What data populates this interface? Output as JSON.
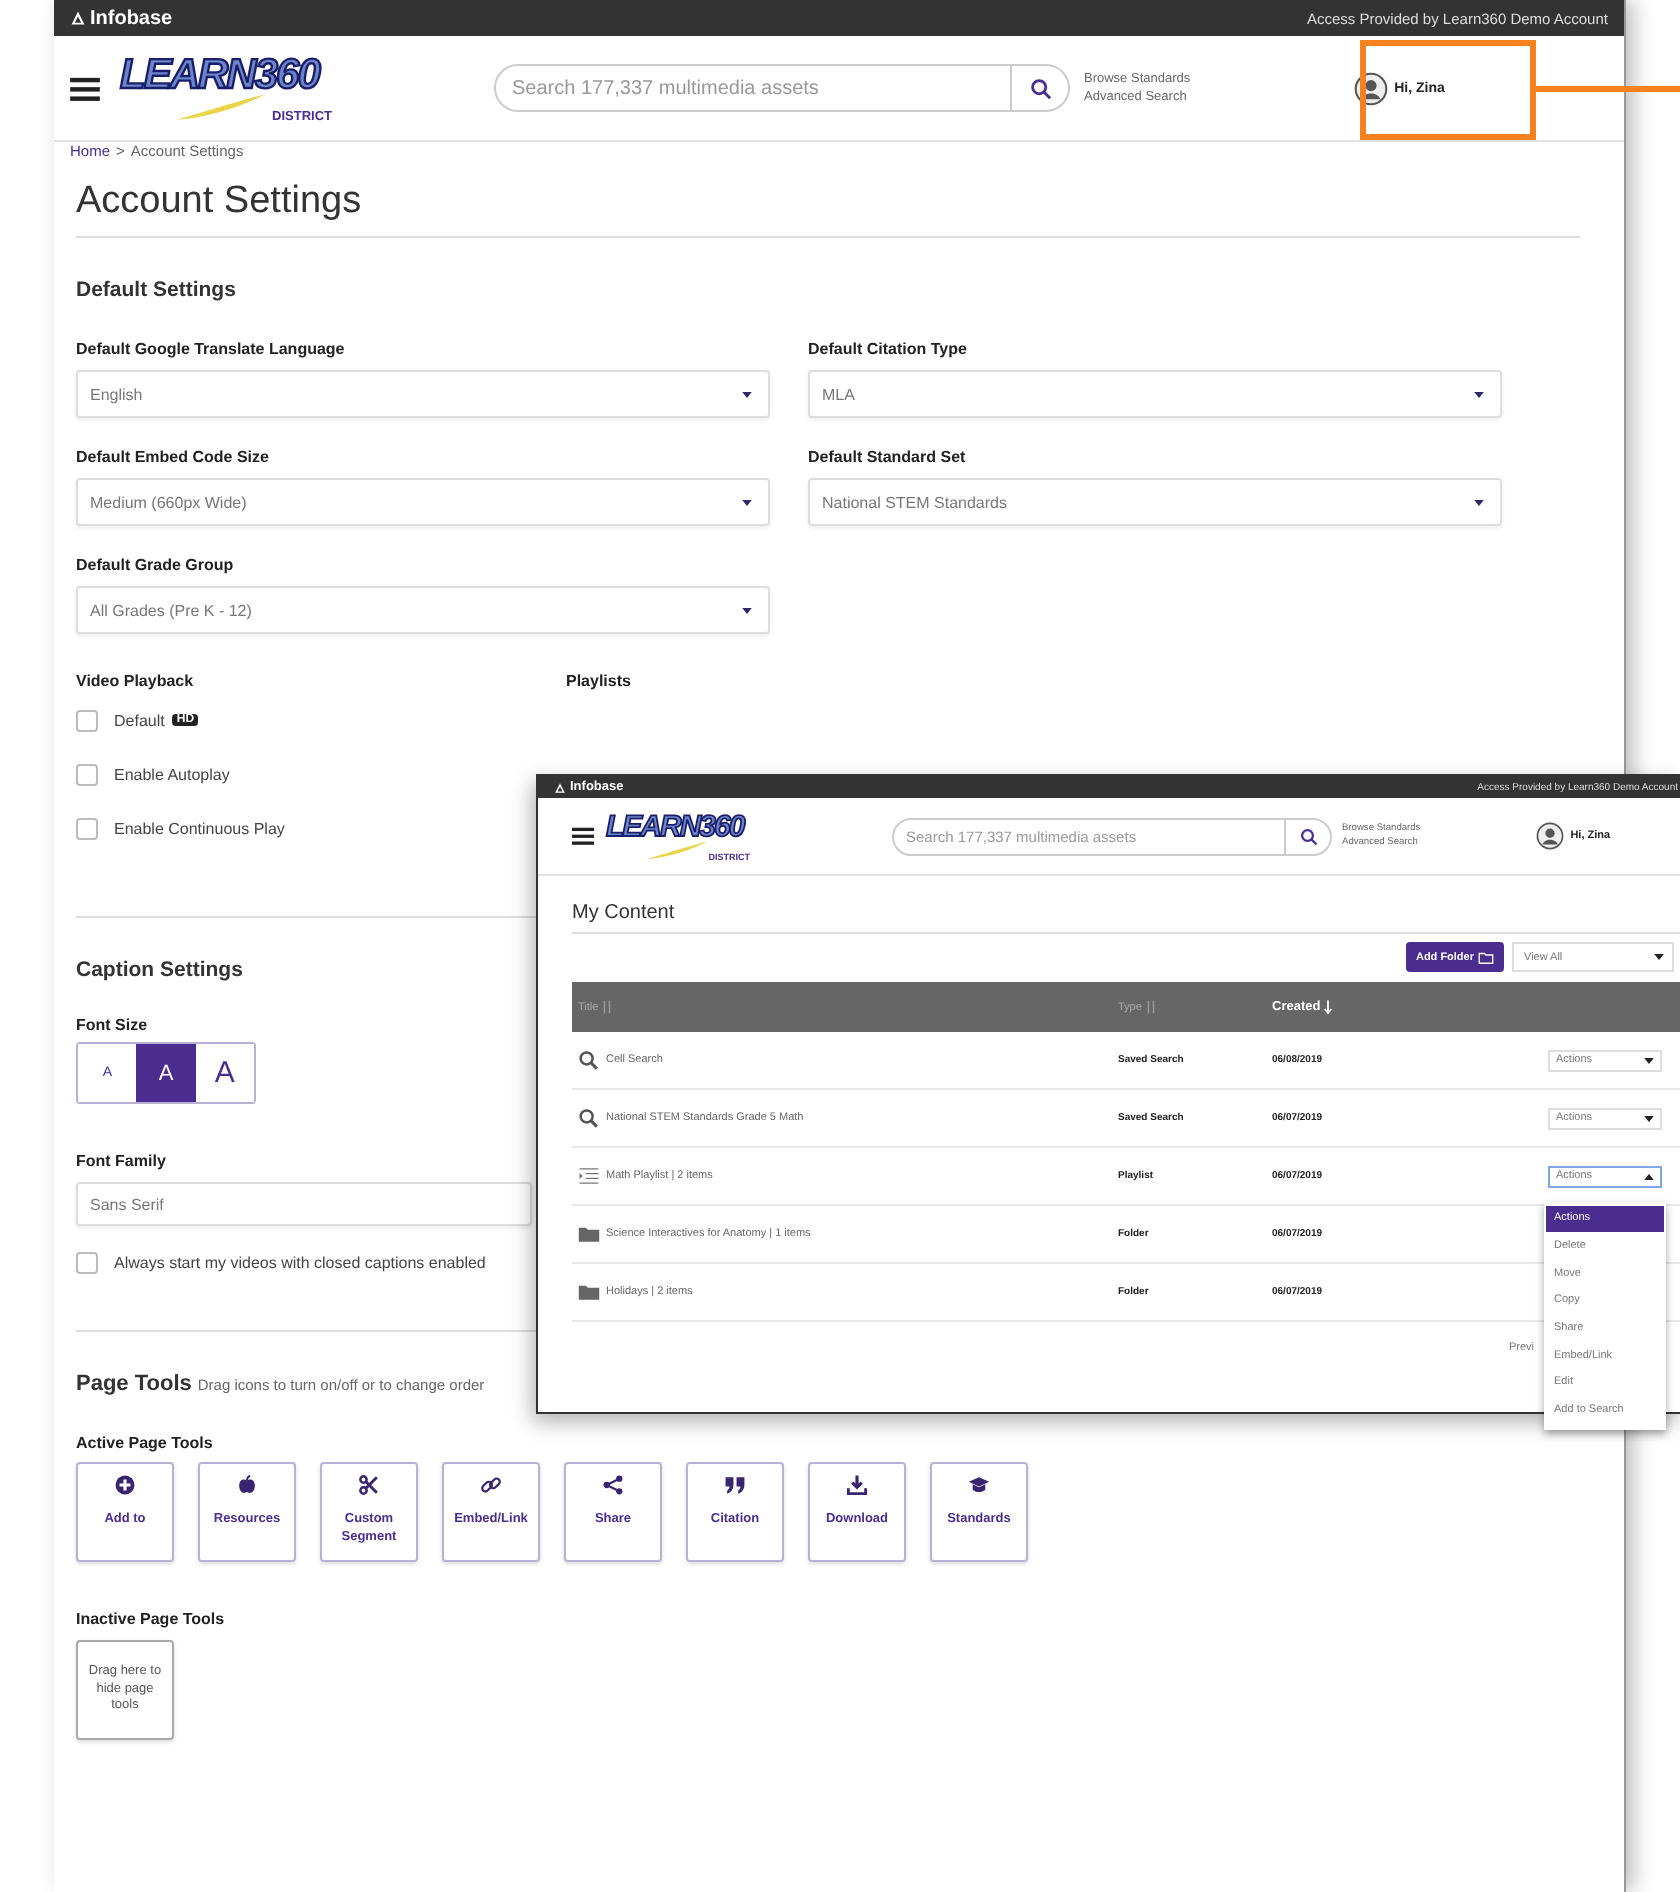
{
  "main": {
    "topbar": {
      "brand": "Infobase",
      "access": "Access Provided by Learn360 Demo Account"
    },
    "header": {
      "logo": "LEARN360",
      "logo_sub": "DISTRICT",
      "search_placeholder": "Search 177,337 multimedia assets",
      "links": [
        "Browse Standards",
        "Advanced Search"
      ],
      "user": "Hi, Zina",
      "user_highlighted": true
    },
    "breadcrumb": {
      "home": "Home",
      "separator": ">",
      "current": "Account Settings"
    },
    "title": "Account Settings",
    "default_settings": {
      "heading": "Default Settings",
      "selects": [
        {
          "label": "Default Google Translate Language",
          "value": "English"
        },
        {
          "label": "Default Citation Type",
          "value": "MLA"
        },
        {
          "label": "Default Embed Code Size",
          "value": "Medium (660px Wide)"
        },
        {
          "label": "Default Standard Set",
          "value": "National STEM Standards"
        },
        {
          "label": "Default Grade Group",
          "value": "All Grades (Pre K - 12)"
        }
      ]
    },
    "video_playback": {
      "heading": "Video Playback",
      "options": [
        {
          "label": "Default",
          "badge": "HD",
          "checked": false
        },
        {
          "label": "Enable Autoplay",
          "checked": false
        },
        {
          "label": "Enable Continuous Play",
          "checked": false
        }
      ]
    },
    "playlists": {
      "heading": "Playlists"
    },
    "caption_settings": {
      "heading": "Caption Settings",
      "font_size_label": "Font Size",
      "font_sizes": [
        {
          "label": "A",
          "kind": "small",
          "selected": false
        },
        {
          "label": "A",
          "kind": "medium",
          "selected": true
        },
        {
          "label": "A",
          "kind": "large",
          "selected": false
        }
      ],
      "font_family_label": "Font Family",
      "font_family": "Sans Serif",
      "closed_captions": {
        "label": "Always start my videos with closed captions enabled",
        "checked": false
      }
    },
    "page_tools": {
      "heading": "Page Tools",
      "hint": "Drag icons to turn on/off or to change order",
      "active_label": "Active Page Tools",
      "active": [
        {
          "label": "Add to",
          "kind": "add"
        },
        {
          "label": "Resources",
          "kind": "resources"
        },
        {
          "label": "Custom Segment",
          "kind": "segment"
        },
        {
          "label": "Embed/Link",
          "kind": "link"
        },
        {
          "label": "Share",
          "kind": "share"
        },
        {
          "label": "Citation",
          "kind": "citation"
        },
        {
          "label": "Download",
          "kind": "download"
        },
        {
          "label": "Standards",
          "kind": "standards"
        }
      ],
      "inactive_label": "Inactive Page Tools",
      "inactive_hint": "Drag here to hide page tools"
    }
  },
  "overlay_window": {
    "topbar": {
      "brand": "Infobase",
      "access": "Access Provided by Learn360 Demo Account"
    },
    "header": {
      "logo": "LEARN360",
      "logo_sub": "DISTRICT",
      "search_placeholder": "Search 177,337 multimedia assets",
      "links": [
        "Browse Standards",
        "Advanced Search"
      ],
      "user": "Hi, Zina"
    },
    "title": "My Content",
    "add_folder": "Add Folder",
    "view_filter": "View All",
    "table": {
      "columns": [
        {
          "label": "Title",
          "sorted": false
        },
        {
          "label": "Type",
          "sorted": false
        },
        {
          "label": "Created",
          "sorted": true
        }
      ],
      "rows": [
        {
          "kind": "saved-search",
          "title": "Cell Search",
          "type": "Saved Search",
          "created": "06/08/2019",
          "actions": "Actions",
          "actions_open": false
        },
        {
          "kind": "saved-search",
          "title": "National STEM Standards Grade 5 Math",
          "type": "Saved Search",
          "created": "06/07/2019",
          "actions": "Actions",
          "actions_open": false
        },
        {
          "kind": "playlist",
          "title": "Math Playlist | 2 items",
          "type": "Playlist",
          "created": "06/07/2019",
          "actions": "Actions",
          "actions_open": true
        },
        {
          "kind": "folder",
          "title": "Science Interactives for Anatomy | 1 items",
          "type": "Folder",
          "created": "06/07/2019"
        },
        {
          "kind": "folder",
          "title": "Holidays | 2 items",
          "type": "Folder",
          "created": "06/07/2019"
        }
      ]
    },
    "actions_menu": [
      {
        "label": "Actions",
        "selected": true
      },
      {
        "label": "Delete",
        "selected": false
      },
      {
        "label": "Move",
        "selected": false
      },
      {
        "label": "Copy",
        "selected": false
      },
      {
        "label": "Share",
        "selected": false
      },
      {
        "label": "Embed/Link",
        "selected": false
      },
      {
        "label": "Edit",
        "selected": false
      },
      {
        "label": "Add to Search",
        "selected": false
      }
    ],
    "pagination": "Previ"
  }
}
